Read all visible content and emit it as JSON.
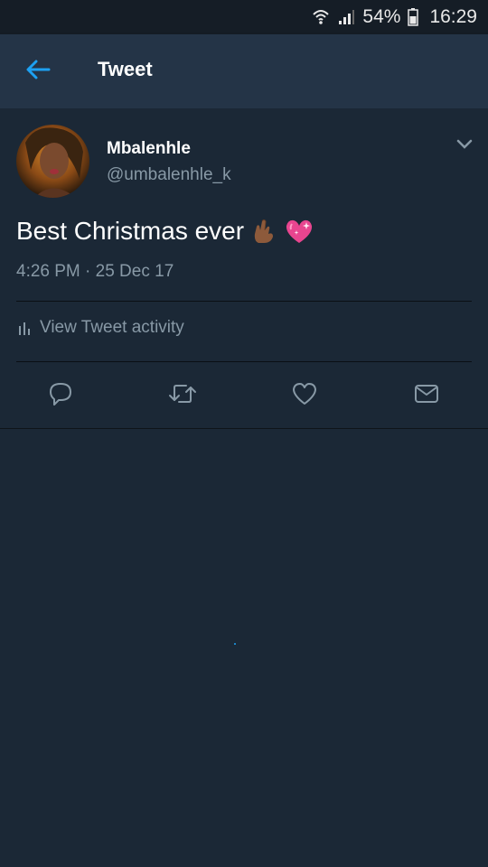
{
  "status_bar": {
    "battery": "54%",
    "time": "16:29"
  },
  "header": {
    "title": "Tweet"
  },
  "tweet": {
    "display_name": "Mbalenhle",
    "handle": "@umbalenhle_k",
    "text": "Best Christmas ever",
    "timestamp": "4:26 PM · 25 Dec 17",
    "activity_label": "View Tweet activity"
  },
  "colors": {
    "background": "#1b2836",
    "header": "#243447",
    "accent": "#1da1f2",
    "secondary_text": "#8899a6"
  },
  "icons": [
    "wifi-icon",
    "signal-icon",
    "battery-icon",
    "back-arrow-icon",
    "chevron-down-icon",
    "finger-crossed-emoji",
    "sparkling-heart-emoji",
    "bar-chart-icon",
    "reply-icon",
    "retweet-icon",
    "like-icon",
    "direct-message-icon"
  ]
}
